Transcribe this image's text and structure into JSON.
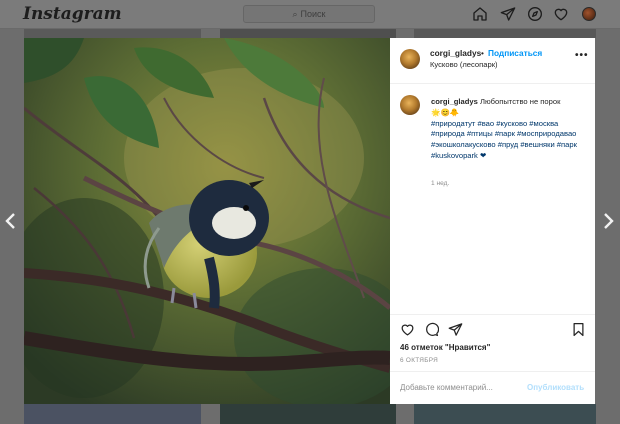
{
  "topbar": {
    "logo": "Instagram",
    "search_placeholder": "Поиск",
    "nav_icons": [
      "home-icon",
      "direct-icon",
      "explore-icon",
      "heart-icon",
      "profile-avatar"
    ]
  },
  "post": {
    "username": "corgi_gladys",
    "bullet": "•",
    "follow_label": "Подписаться",
    "location": "Кусково (лесопарк)",
    "more_label": "•••",
    "caption": {
      "username": "corgi_gladys",
      "text": "Любопытство не порок",
      "emoji": "🌟😊🐥",
      "hashtags": "#природатут #вао #кусково #москва #природа #птицы #парк #мосприродавао #экошколакусково #пруд #вешняки #парк #kuskovopark ❤"
    },
    "time_ago": "1 нед.",
    "likes": "46 отметок \"Нравится\"",
    "date": "6 ОКТЯБРЯ",
    "comment_placeholder": "Добавьте комментарий...",
    "publish_label": "Опубликовать"
  },
  "colors": {
    "accent": "#0095f6",
    "publish_disabled": "#b2dffc",
    "hashtag": "#00376b",
    "overlay": "#6d6d6d"
  }
}
